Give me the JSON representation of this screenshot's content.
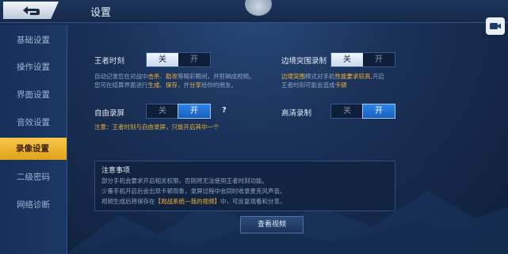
{
  "header": {
    "title": "设置"
  },
  "sidebar": {
    "items": [
      {
        "label": "基础设置"
      },
      {
        "label": "操作设置"
      },
      {
        "label": "界面设置"
      },
      {
        "label": "音效设置"
      },
      {
        "label": "录像设置",
        "active": true
      },
      {
        "label": "二级密码"
      },
      {
        "label": "网络诊断"
      }
    ]
  },
  "settings": {
    "king_moment": {
      "label": "王者时刻",
      "off": "关",
      "on": "开",
      "state": "off",
      "desc_line1_a": "自动记录您在对战中",
      "desc_line1_b": "击杀",
      "desc_line1_c": "、",
      "desc_line1_d": "助攻",
      "desc_line1_e": "等精彩瞬间，并剪辑成视频。",
      "desc_line2_a": "您可在结算界面进行",
      "desc_line2_b": "生成",
      "desc_line2_c": "、",
      "desc_line2_d": "保存",
      "desc_line2_e": "，并",
      "desc_line2_f": "分享",
      "desc_line2_g": "给你的朋友。"
    },
    "edge_record": {
      "label": "边境突围录制",
      "off": "关",
      "on": "开",
      "state": "off",
      "desc_line1_a": "边境突围",
      "desc_line1_b": "模式对手机",
      "desc_line1_c": "性能要求较高",
      "desc_line1_d": ",开启",
      "desc_line2_a": "王者时刻可能会造成",
      "desc_line2_b": "卡顿"
    },
    "free_record": {
      "label": "自由录屏",
      "off": "关",
      "on": "开",
      "state": "on",
      "help": "?",
      "warning": "注意：王者时刻与自由录屏，只能开启其中一个"
    },
    "hd_record": {
      "label": "高清录制",
      "off": "关",
      "on": "开",
      "state": "on"
    }
  },
  "notice": {
    "title": "注意事项",
    "line1": "部分手机会要求开启相关权限，否则将无法使用王者时刻功能。",
    "line2": "少量手机开启后会出现卡顿现象，录屏过程中会同时收录麦克风声音。",
    "line3_a": "视频生成后将保存在",
    "line3_b": "【观战系统—我的视频】",
    "line3_c": "中，可反复观看和分享。"
  },
  "buttons": {
    "view_video": "查看视频"
  },
  "icons": {
    "back": "back-arrow-icon",
    "record": "video-record-icon"
  },
  "colors": {
    "accent_gold": "#f2b53b",
    "toggle_blue": "#2b84e6",
    "active_tab": "#e0a21a"
  }
}
